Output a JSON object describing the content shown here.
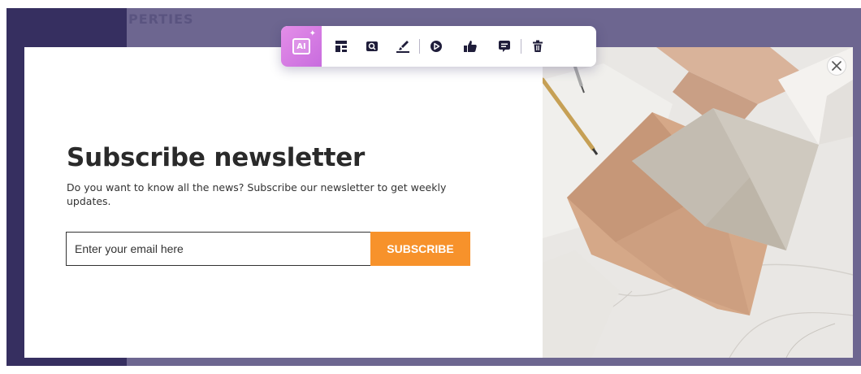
{
  "background": {
    "heading_fragment": "PERTIES"
  },
  "modal": {
    "title": "Subscribe newsletter",
    "description": "Do you want to know all the news? Subscribe our newsletter to get weekly updates.",
    "email_placeholder": "Enter your email here",
    "subscribe_label": "SUBSCRIBE",
    "close_icon": "close-icon",
    "photo_subject": "envelopes-and-pencil-on-marble"
  },
  "toolbar": {
    "ai_label": "AI",
    "icons": [
      "ai-icon",
      "layout-icon",
      "preview-icon",
      "brush-icon",
      "play-icon",
      "thumbs-up-icon",
      "comment-icon",
      "trash-icon"
    ]
  },
  "colors": {
    "accent": "#f7922b",
    "backdrop": "#6d6690",
    "backdrop_dark": "#362f60",
    "toolbar_icon": "#1f1d3a",
    "ai_gradient_start": "#e48ee8",
    "ai_gradient_end": "#c86cde"
  }
}
